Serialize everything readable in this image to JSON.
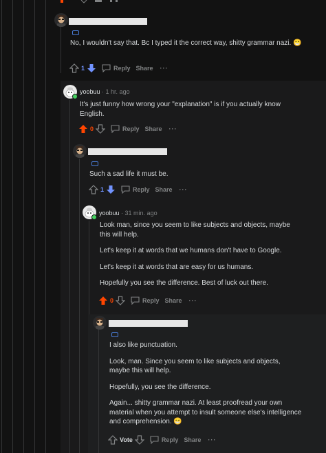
{
  "comments": [
    {
      "username": "",
      "time": "",
      "body": [
        "No, I wouldn't say that. Bc I typed it the correct way, shitty grammar nazi. 😁"
      ],
      "vote_count": "1",
      "reply_label": "Reply",
      "share_label": "Share"
    },
    {
      "username": "yoobuu",
      "time": "· 1 hr. ago",
      "body": [
        "It's just funny how wrong your \"explanation\" is if you actually know English."
      ],
      "vote_count": "0",
      "reply_label": "Reply",
      "share_label": "Share"
    },
    {
      "username": "",
      "time": "",
      "body": [
        "Such a sad life it must be."
      ],
      "vote_count": "1",
      "reply_label": "Reply",
      "share_label": "Share"
    },
    {
      "username": "yoobuu",
      "time": "· 31 min. ago",
      "body": [
        "Look man, since you seem to like subjects and objects, maybe this will help.",
        "Let's keep it at words that we humans don't have to Google.",
        "Let's keep it at words that are easy for us humans.",
        "Hopefully you see the difference. Best of luck out there."
      ],
      "vote_count": "0",
      "reply_label": "Reply",
      "share_label": "Share"
    },
    {
      "username": "",
      "time": "",
      "body": [
        "I also like punctuation.",
        "Look, man. Since you seem to like subjects and objects, maybe this will help.",
        "Hopefully, you see the difference.",
        "Again... shitty grammar nazi. At least proofread your own material when you attempt to insult someone else's intelligence and comprehension. 😁"
      ],
      "vote_label": "Vote",
      "reply_label": "Reply",
      "share_label": "Share"
    }
  ],
  "colors": {
    "upvote_active": "#ff4500",
    "downvote_active": "#7193ff",
    "background": "#121212",
    "panel": "#1a1a1b",
    "online": "#46d160"
  },
  "icons": {
    "upvote": "arrow-up-icon",
    "downvote": "arrow-down-icon",
    "reply": "speech-bubble-icon",
    "more": "ellipsis-icon"
  }
}
